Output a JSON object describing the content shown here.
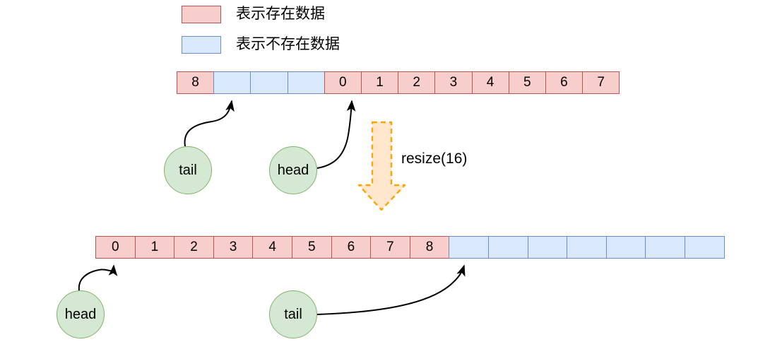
{
  "legend": {
    "items": [
      {
        "label": "表示存在数据",
        "swatch": "present",
        "fill": "#f8cecc",
        "stroke": "#b85450"
      },
      {
        "label": "表示不存在数据",
        "swatch": "absent",
        "fill": "#dae8fc",
        "stroke": "#6c8ebf"
      }
    ]
  },
  "arrays": {
    "before": {
      "capacity": 12,
      "cells": [
        {
          "value": "8",
          "state": "present"
        },
        {
          "value": "",
          "state": "absent"
        },
        {
          "value": "",
          "state": "absent"
        },
        {
          "value": "",
          "state": "absent"
        },
        {
          "value": "0",
          "state": "present"
        },
        {
          "value": "1",
          "state": "present"
        },
        {
          "value": "2",
          "state": "present"
        },
        {
          "value": "3",
          "state": "present"
        },
        {
          "value": "4",
          "state": "present"
        },
        {
          "value": "5",
          "state": "present"
        },
        {
          "value": "6",
          "state": "present"
        },
        {
          "value": "7",
          "state": "present"
        }
      ]
    },
    "after": {
      "capacity": 16,
      "cells": [
        {
          "value": "0",
          "state": "present"
        },
        {
          "value": "1",
          "state": "present"
        },
        {
          "value": "2",
          "state": "present"
        },
        {
          "value": "3",
          "state": "present"
        },
        {
          "value": "4",
          "state": "present"
        },
        {
          "value": "5",
          "state": "present"
        },
        {
          "value": "6",
          "state": "present"
        },
        {
          "value": "7",
          "state": "present"
        },
        {
          "value": "8",
          "state": "present"
        },
        {
          "value": "",
          "state": "absent"
        },
        {
          "value": "",
          "state": "absent"
        },
        {
          "value": "",
          "state": "absent"
        },
        {
          "value": "",
          "state": "absent"
        },
        {
          "value": "",
          "state": "absent"
        },
        {
          "value": "",
          "state": "absent"
        },
        {
          "value": "",
          "state": "absent"
        }
      ]
    }
  },
  "pointers": {
    "tail_top": "tail",
    "head_top": "head",
    "head_bottom": "head",
    "tail_bottom": "tail"
  },
  "operation": {
    "label": "resize(16)",
    "arrow_fill": "#ffe6cc",
    "arrow_stroke": "#ffa500"
  },
  "colors": {
    "present_fill": "#f8cecc",
    "present_stroke": "#b85450",
    "absent_fill": "#dae8fc",
    "absent_stroke": "#6c8ebf",
    "node_fill": "#d5e8d4",
    "node_stroke": "#82b366",
    "connector": "#000000"
  }
}
